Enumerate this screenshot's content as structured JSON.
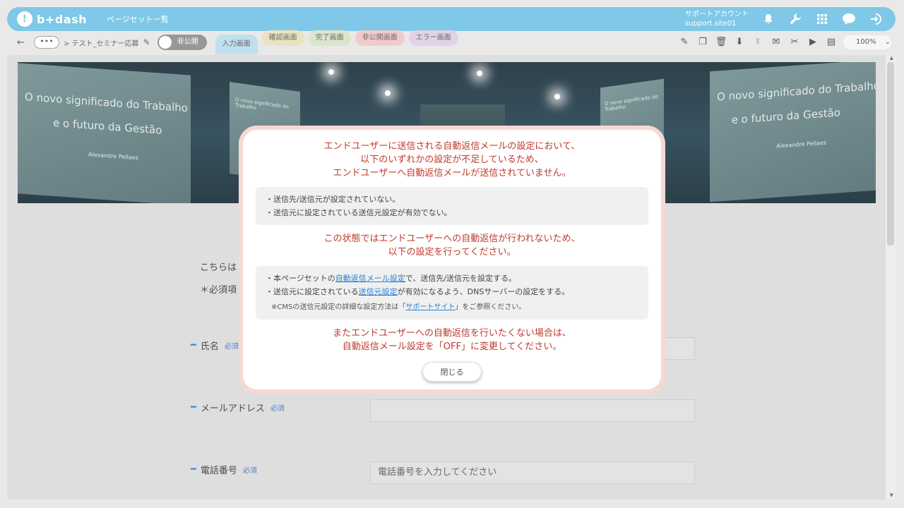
{
  "header": {
    "logo": "b+dash",
    "title": "ページセット一覧",
    "account_label": "サポートアカウント",
    "account_id": "support.site01"
  },
  "subbar": {
    "back_icon": "←",
    "more": "•••",
    "breadcrumb": "> テスト_セミナー応募",
    "toggle_label": "非公開",
    "tabs": [
      "入力画面",
      "確認画面",
      "完了画面",
      "非公開画面",
      "エラー画面"
    ],
    "zoom": "100%"
  },
  "banner": {
    "left_line1": "O novo significado do Trabalho",
    "left_line2": "e o futuro da Gestão",
    "right_line1": "O novo significado do Trabalho",
    "right_line2": "e o futuro da Gestão",
    "presenter": "Alexandre Pellaes"
  },
  "form": {
    "intro": "こちらは",
    "required_note": "＊必須項",
    "fields": [
      {
        "label": "氏名",
        "required": "必須",
        "placeholder": ""
      },
      {
        "label": "メールアドレス",
        "required": "必須",
        "placeholder": ""
      },
      {
        "label": "電話番号",
        "required": "必須",
        "placeholder": "電話番号を入力してください"
      }
    ]
  },
  "modal": {
    "warning_lines": [
      "エンドユーザーに送信される自動返信メールの設定において、",
      "以下のいずれかの設定が不足しているため、",
      "エンドユーザーへ自動返信メールが送信されていません。"
    ],
    "causes": [
      "・送信先/送信元が設定されていない。",
      "・送信元に設定されている送信元設定が有効でない。"
    ],
    "action_lines": [
      "この状態ではエンドユーザーへの自動返信が行われないため、",
      "以下の設定を行ってください。"
    ],
    "step1_pre": "・本ページセットの",
    "step1_link": "自動返信メール設定",
    "step1_post": "で、送信先/送信元を設定する。",
    "step2_pre": "・送信元に設定されている",
    "step2_link": "送信元設定",
    "step2_post": "が有効になるよう、DNSサーバーの設定をする。",
    "note_pre": "※CMSの送信元設定の詳細な設定方法は「",
    "note_link": "サポートサイト",
    "note_post": "」をご参照ください。",
    "off_lines": [
      "またエンドユーザーへの自動返信を行いたくない場合は、",
      "自動返信メール設定を「OFF」に変更してください。"
    ],
    "close_label": "閉じる"
  }
}
